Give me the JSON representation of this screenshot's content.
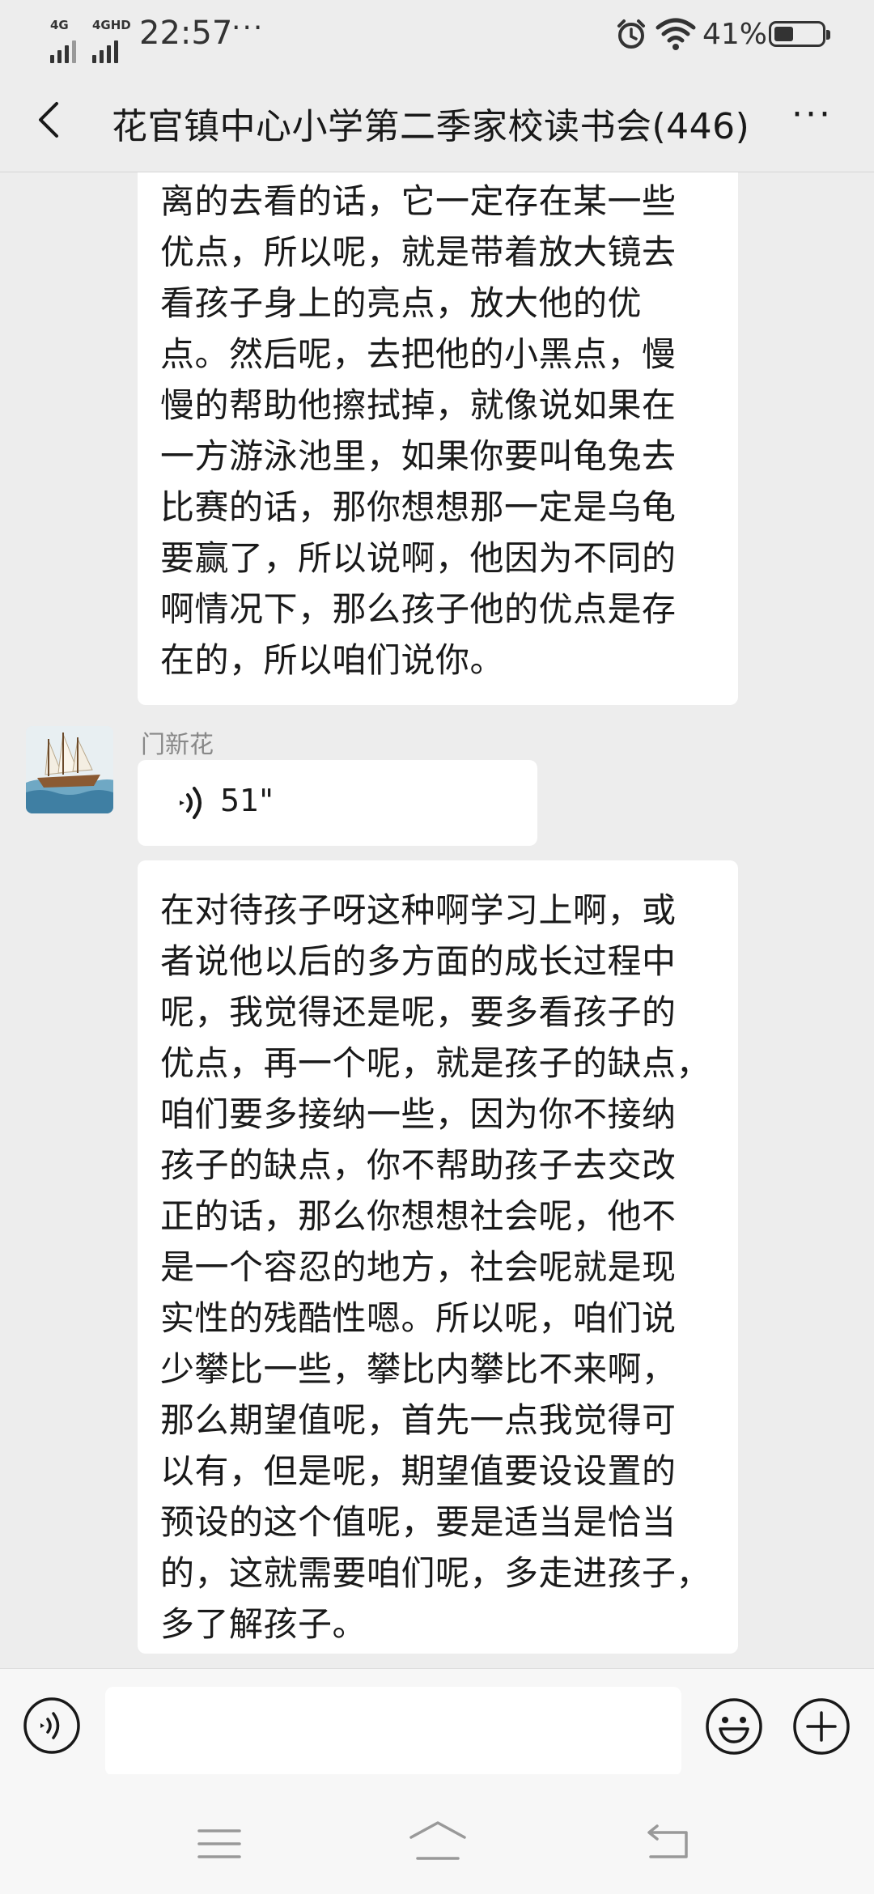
{
  "status_bar": {
    "signal1_label": "4G",
    "signal2_label": "4GHD",
    "time": "22:57",
    "overflow": "···",
    "battery_percent": "41%",
    "battery_level": 0.41,
    "icons": [
      "alarm-icon",
      "wifi-icon",
      "battery-icon"
    ]
  },
  "header": {
    "back_icon": "chevron-left-icon",
    "title": "花官镇中心小学第二季家校读书会(446)",
    "more": "···"
  },
  "messages": {
    "msg1": {
      "lines": [
        "离的去看的话，它一定存在某一些",
        "优点，所以呢，就是带着放大镜去",
        "看孩子身上的亮点，放大他的优",
        "点。然后呢，去把他的小黑点，慢",
        "慢的帮助他擦拭掉，就像说如果在",
        "一方游泳池里，如果你要叫龟兔去",
        "比赛的话，那你想想那一定是乌龟",
        "要赢了，所以说啊，他因为不同的",
        "啊情况下，那么孩子他的优点是存",
        "在的，所以咱们说你。"
      ]
    },
    "msg2": {
      "sender": "门新花",
      "duration": "51\"",
      "avatar_icon": "sailing-ship-avatar"
    },
    "msg3": {
      "lines": [
        "在对待孩子呀这种啊学习上啊，或",
        "者说他以后的多方面的成长过程中",
        "呢，我觉得还是呢，要多看孩子的",
        "优点，再一个呢，就是孩子的缺点，",
        "咱们要多接纳一些，因为你不接纳",
        "孩子的缺点，你不帮助孩子去交改",
        "正的话，那么你想想社会呢，他不",
        "是一个容忍的地方，社会呢就是现",
        "实性的残酷性嗯。所以呢，咱们说",
        "少攀比一些，攀比内攀比不来啊，",
        "那么期望值呢，首先一点我觉得可",
        "以有，但是呢，期望值要设设置的",
        "预设的这个值呢，要是适当是恰当",
        "的，这就需要咱们呢，多走进孩子，",
        "多了解孩子。"
      ]
    }
  },
  "input_bar": {
    "voice_icon": "voice-input-icon",
    "text_value": "",
    "emoji_icon": "emoji-icon",
    "plus_icon": "plus-icon"
  },
  "nav_bar": {
    "icons": [
      "menu-icon",
      "home-icon",
      "back-icon"
    ]
  }
}
